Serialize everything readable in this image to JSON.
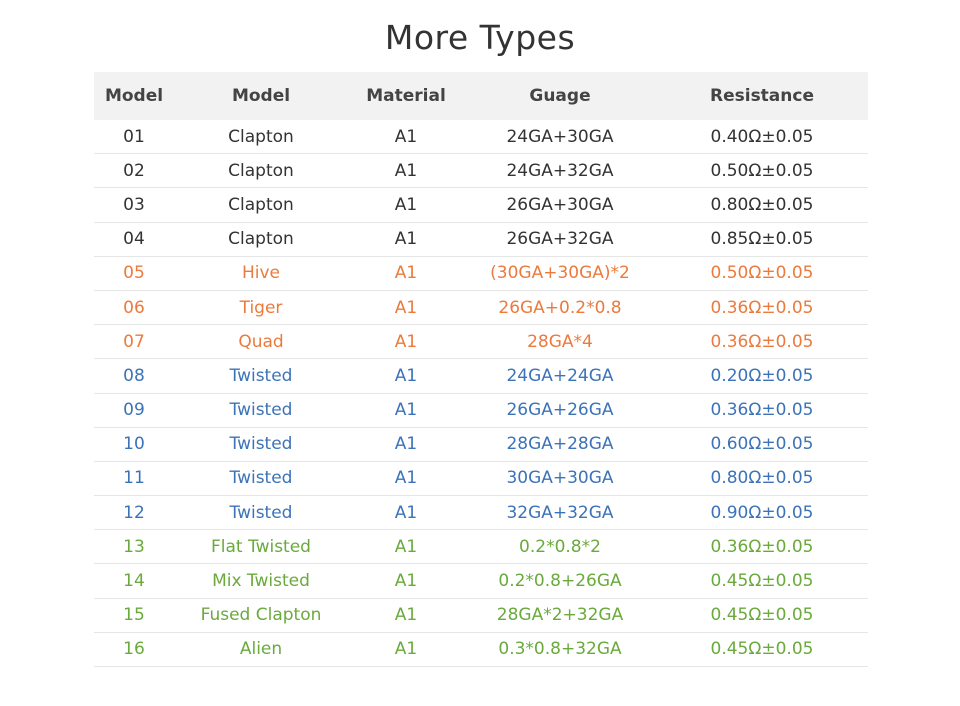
{
  "title": "More Types",
  "table": {
    "headers": [
      "Model",
      "Model",
      "Material",
      "Guage",
      "Resistance"
    ],
    "rows": [
      {
        "id": "01",
        "model": "Clapton",
        "material": "A1",
        "gauge": "24GA+30GA",
        "resistance": "0.40Ω±0.05",
        "group": "gray"
      },
      {
        "id": "02",
        "model": "Clapton",
        "material": "A1",
        "gauge": "24GA+32GA",
        "resistance": "0.50Ω±0.05",
        "group": "gray"
      },
      {
        "id": "03",
        "model": "Clapton",
        "material": "A1",
        "gauge": "26GA+30GA",
        "resistance": "0.80Ω±0.05",
        "group": "gray"
      },
      {
        "id": "04",
        "model": "Clapton",
        "material": "A1",
        "gauge": "26GA+32GA",
        "resistance": "0.85Ω±0.05",
        "group": "gray"
      },
      {
        "id": "05",
        "model": "Hive",
        "material": "A1",
        "gauge": "(30GA+30GA)*2",
        "resistance": "0.50Ω±0.05",
        "group": "orange"
      },
      {
        "id": "06",
        "model": "Tiger",
        "material": "A1",
        "gauge": "26GA+0.2*0.8",
        "resistance": "0.36Ω±0.05",
        "group": "orange"
      },
      {
        "id": "07",
        "model": "Quad",
        "material": "A1",
        "gauge": "28GA*4",
        "resistance": "0.36Ω±0.05",
        "group": "orange"
      },
      {
        "id": "08",
        "model": "Twisted",
        "material": "A1",
        "gauge": "24GA+24GA",
        "resistance": "0.20Ω±0.05",
        "group": "blue"
      },
      {
        "id": "09",
        "model": "Twisted",
        "material": "A1",
        "gauge": "26GA+26GA",
        "resistance": "0.36Ω±0.05",
        "group": "blue"
      },
      {
        "id": "10",
        "model": "Twisted",
        "material": "A1",
        "gauge": "28GA+28GA",
        "resistance": "0.60Ω±0.05",
        "group": "blue"
      },
      {
        "id": "11",
        "model": "Twisted",
        "material": "A1",
        "gauge": "30GA+30GA",
        "resistance": "0.80Ω±0.05",
        "group": "blue"
      },
      {
        "id": "12",
        "model": "Twisted",
        "material": "A1",
        "gauge": "32GA+32GA",
        "resistance": "0.90Ω±0.05",
        "group": "blue"
      },
      {
        "id": "13",
        "model": "Flat Twisted",
        "material": "A1",
        "gauge": "0.2*0.8*2",
        "resistance": "0.36Ω±0.05",
        "group": "green"
      },
      {
        "id": "14",
        "model": "Mix Twisted",
        "material": "A1",
        "gauge": "0.2*0.8+26GA",
        "resistance": "0.45Ω±0.05",
        "group": "green"
      },
      {
        "id": "15",
        "model": "Fused Clapton",
        "material": "A1",
        "gauge": "28GA*2+32GA",
        "resistance": "0.45Ω±0.05",
        "group": "green"
      },
      {
        "id": "16",
        "model": "Alien",
        "material": "A1",
        "gauge": "0.3*0.8+32GA",
        "resistance": "0.45Ω±0.05",
        "group": "green"
      }
    ]
  },
  "colors": {
    "gray": "#333333",
    "orange": "#ec7a3c",
    "blue": "#3c73b8",
    "green": "#6aaa3c",
    "header_bg": "#f2f2f2"
  }
}
